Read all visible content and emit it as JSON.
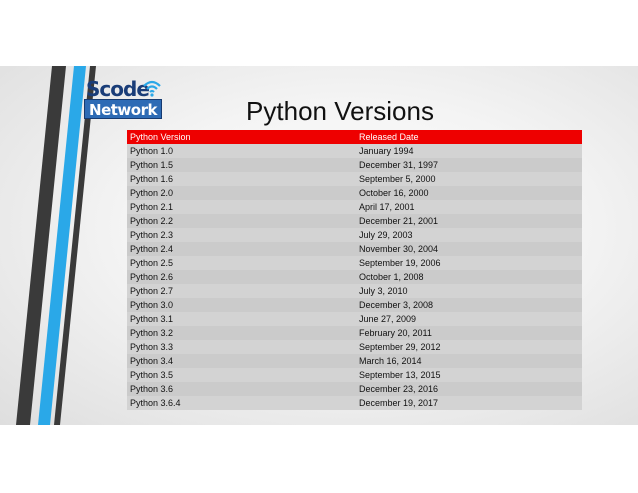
{
  "logo": {
    "line1": "Scode",
    "line2": "Network"
  },
  "title": "Python Versions",
  "table": {
    "headers": [
      "Python Version",
      "Released Date"
    ],
    "rows": [
      [
        "Python 1.0",
        "January 1994"
      ],
      [
        "Python 1.5",
        "December 31, 1997"
      ],
      [
        "Python 1.6",
        "September 5, 2000"
      ],
      [
        "Python 2.0",
        "October 16, 2000"
      ],
      [
        "Python 2.1",
        "April 17, 2001"
      ],
      [
        "Python 2.2",
        "December 21, 2001"
      ],
      [
        "Python 2.3",
        "July 29, 2003"
      ],
      [
        "Python 2.4",
        "November 30, 2004"
      ],
      [
        "Python 2.5",
        "September 19, 2006"
      ],
      [
        "Python 2.6",
        "October 1, 2008"
      ],
      [
        "Python 2.7",
        "July 3, 2010"
      ],
      [
        "Python 3.0",
        "December 3, 2008"
      ],
      [
        "Python 3.1",
        "June 27, 2009"
      ],
      [
        "Python 3.2",
        "February 20, 2011"
      ],
      [
        "Python 3.3",
        "September 29, 2012"
      ],
      [
        "Python 3.4",
        "March 16, 2014"
      ],
      [
        "Python 3.5",
        "September 13, 2015"
      ],
      [
        "Python 3.6",
        "December 23, 2016"
      ],
      [
        "Python 3.6.4",
        "December 19, 2017"
      ]
    ]
  },
  "colors": {
    "header_bg": "#ee0000",
    "stripe_blue": "#2aa8e8",
    "stripe_dark": "#3a3a3a",
    "logo_blue": "#2d6bb5"
  },
  "icons": {
    "logo_signal": "wifi-icon"
  }
}
